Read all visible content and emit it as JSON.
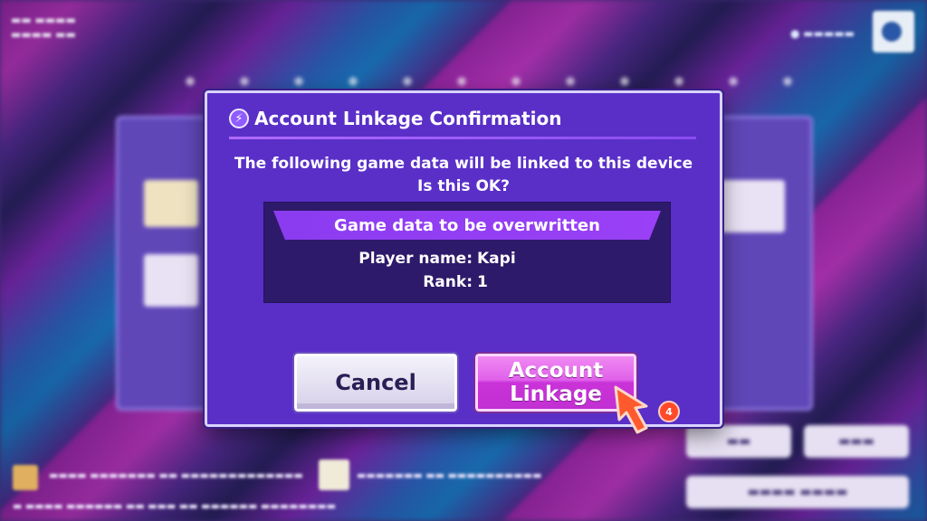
{
  "dialog": {
    "title": "Account Linkage Confirmation",
    "title_icon": "lightning-bolt-icon",
    "message_line1": "The following game data will be linked to this device",
    "message_line2": "Is this OK?",
    "data_header": "Game data to be overwritten",
    "player_name_label": "Player name:",
    "player_name_value": "Kapi",
    "rank_label": "Rank:",
    "rank_value": "1",
    "cancel_label": "Cancel",
    "link_label_line1": "Account",
    "link_label_line2": "Linkage"
  },
  "step_badge": "4",
  "colors": {
    "dialog_bg": "#5a2fc8",
    "accent_purple": "#9a40f6",
    "link_button": "#e061ea",
    "pointer": "#ff5a2e"
  }
}
